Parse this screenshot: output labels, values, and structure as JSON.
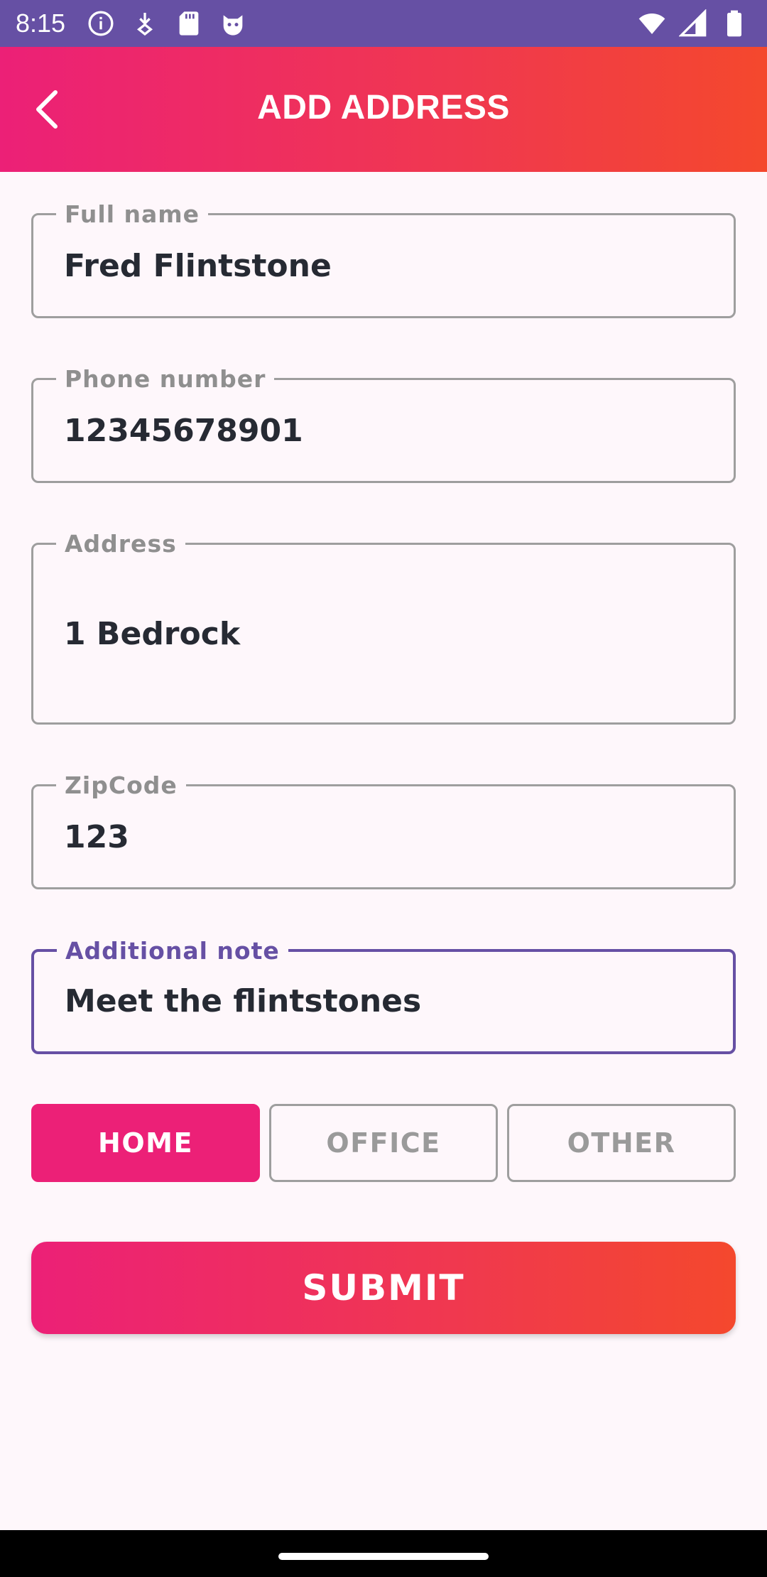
{
  "status_bar": {
    "time": "8:15",
    "left_icons": [
      "info-icon",
      "download-icon",
      "sd-card-icon",
      "cat-face-icon"
    ],
    "right_icons": [
      "wifi-icon",
      "signal-icon",
      "battery-icon"
    ],
    "color": "#6650A4"
  },
  "app_bar": {
    "title": "ADD ADDRESS",
    "back_icon": "chevron-left-icon",
    "gradient": [
      "#EC2077",
      "#F4482D"
    ]
  },
  "form": {
    "full_name": {
      "label": "Full name",
      "value": "Fred Flintstone"
    },
    "phone": {
      "label": "Phone number",
      "value": "12345678901"
    },
    "address": {
      "label": "Address",
      "value": "1 Bedrock"
    },
    "zipcode": {
      "label": "ZipCode",
      "value": "123"
    },
    "note": {
      "label": "Additional note",
      "value": "Meet the flintstones",
      "focused": true
    }
  },
  "address_types": {
    "options": [
      "HOME",
      "OFFICE",
      "OTHER"
    ],
    "selected": "HOME",
    "active_color": "#EC2077"
  },
  "submit": {
    "label": "SUBMIT"
  }
}
